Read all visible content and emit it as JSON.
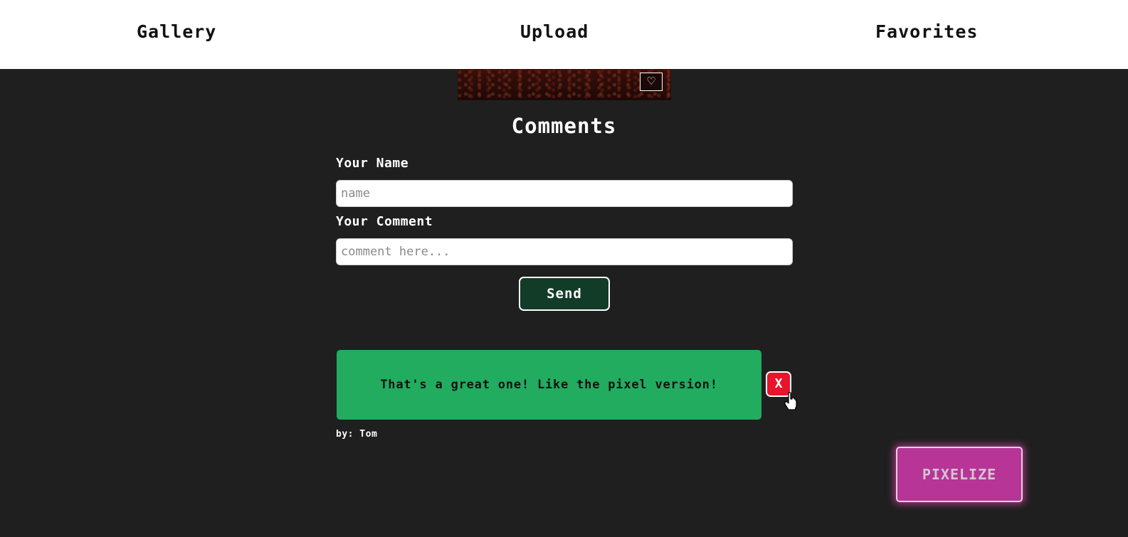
{
  "nav": {
    "gallery": "Gallery",
    "upload": "Upload",
    "favorites": "Favorites"
  },
  "image": {
    "favorite_icon": "heart-outline-icon",
    "favorite_glyph": "♡"
  },
  "comments": {
    "title": "Comments",
    "name_label": "Your Name",
    "name_placeholder": "name",
    "comment_label": "Your Comment",
    "comment_placeholder": "comment here...",
    "send_label": "Send"
  },
  "comment_list": [
    {
      "text": "That's a great one! Like the pixel version!",
      "byline": "by: Tom",
      "delete_label": "X"
    }
  ],
  "pixelize": {
    "label": "PIXELIZE"
  },
  "colors": {
    "background": "#1f1f1f",
    "nav_background": "#ffffff",
    "send_button": "#123b28",
    "comment_card": "#21ac5f",
    "delete_button": "#e8142b",
    "pixelize_button": "#b73597"
  }
}
